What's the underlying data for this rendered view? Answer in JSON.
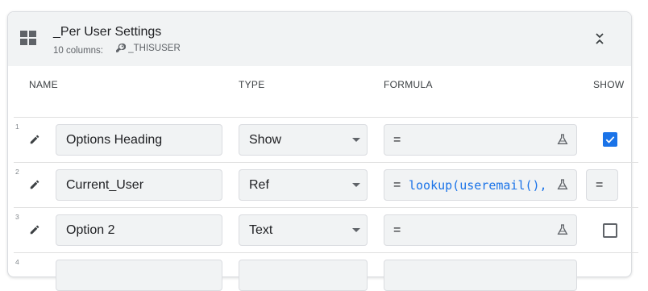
{
  "table": {
    "title": "_Per User Settings",
    "columns_label": "10 columns:",
    "key_column": "_THISUSER",
    "header_icon": "table-grid-icon",
    "collapse_icon": "chevron-collapse-icon"
  },
  "columns": {
    "name": "NAME",
    "type": "TYPE",
    "formula": "FORMULA",
    "show": "SHOW"
  },
  "rows": [
    {
      "num": "1",
      "name": "Options Heading",
      "type": "Show",
      "formula_eq": "=",
      "formula_expr": "",
      "show": "checked"
    },
    {
      "num": "2",
      "name": "Current_User",
      "type": "Ref",
      "formula_eq": "=",
      "formula_expr": "lookup(useremail(),",
      "show": "formula",
      "show_text": "= "
    },
    {
      "num": "3",
      "name": "Option 2",
      "type": "Text",
      "formula_eq": "=",
      "formula_expr": "",
      "show": "unchecked"
    },
    {
      "num": "4"
    }
  ],
  "colors": {
    "accent": "#1a73e8",
    "header_bg": "#f1f3f4",
    "field_bg": "#f1f3f4"
  }
}
